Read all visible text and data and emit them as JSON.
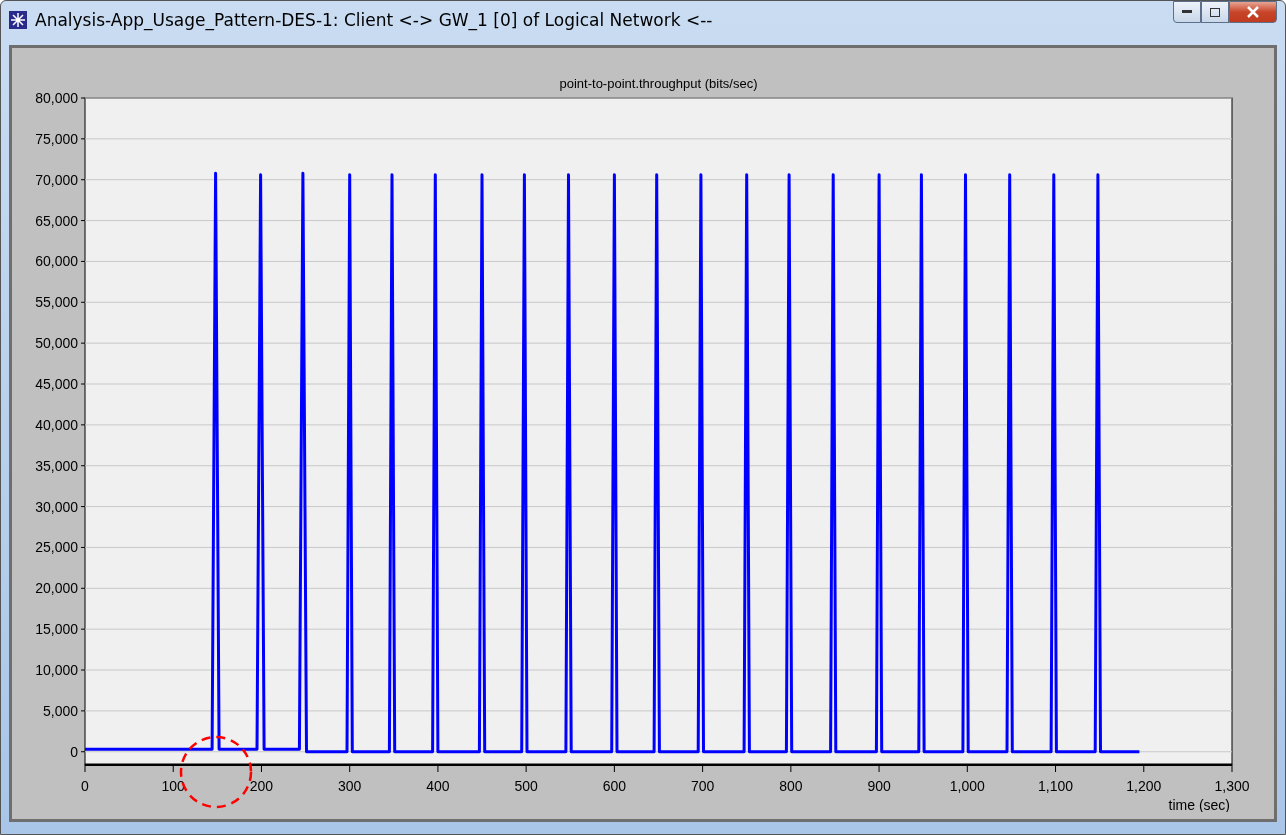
{
  "window": {
    "title": "Analysis-App_Usage_Pattern-DES-1: Client <-> GW_1 [0] of Logical Network <--"
  },
  "chart": {
    "chart_data": {
      "type": "line",
      "grid": true,
      "title": "point-to-point.throughput (bits/sec)",
      "xlabel": "time (sec)",
      "xlim": [
        0,
        1300
      ],
      "ylim": [
        -1500,
        80000
      ],
      "xticks": [
        0,
        100,
        200,
        300,
        400,
        500,
        600,
        700,
        800,
        900,
        {
          "value": 1000,
          "label": "1,000"
        },
        {
          "value": 1100,
          "label": "1,100"
        },
        {
          "value": 1200,
          "label": "1,200"
        },
        {
          "value": 1300,
          "label": "1,300"
        }
      ],
      "yticks": [
        0,
        {
          "value": 5000,
          "label": "5,000"
        },
        {
          "value": 10000,
          "label": "10,000"
        },
        {
          "value": 15000,
          "label": "15,000"
        },
        {
          "value": 20000,
          "label": "20,000"
        },
        {
          "value": 25000,
          "label": "25,000"
        },
        {
          "value": 30000,
          "label": "30,000"
        },
        {
          "value": 35000,
          "label": "35,000"
        },
        {
          "value": 40000,
          "label": "40,000"
        },
        {
          "value": 45000,
          "label": "45,000"
        },
        {
          "value": 50000,
          "label": "50,000"
        },
        {
          "value": 55000,
          "label": "55,000"
        },
        {
          "value": 60000,
          "label": "60,000"
        },
        {
          "value": 65000,
          "label": "65,000"
        },
        {
          "value": 70000,
          "label": "70,000"
        },
        {
          "value": 75000,
          "label": "75,000"
        },
        {
          "value": 80000,
          "label": "80,000"
        }
      ],
      "x": [
        0,
        144,
        148,
        152,
        195,
        199,
        203,
        243,
        247,
        251,
        297,
        300,
        303,
        345,
        348,
        351,
        394,
        397,
        400,
        447,
        450,
        453,
        495,
        498,
        501,
        545,
        548,
        551,
        597,
        600,
        603,
        645,
        648,
        651,
        695,
        698,
        701,
        747,
        750,
        753,
        795,
        798,
        801,
        845,
        848,
        851,
        897,
        900,
        903,
        945,
        948,
        951,
        995,
        998,
        1001,
        1045,
        1048,
        1051,
        1095,
        1098,
        1101,
        1145,
        1148,
        1151,
        1195
      ],
      "series": [
        {
          "color": "#0000ff",
          "values": [
            300,
            300,
            70800,
            300,
            300,
            70600,
            300,
            300,
            70800,
            0,
            0,
            70600,
            0,
            0,
            70600,
            0,
            0,
            70600,
            0,
            0,
            70600,
            0,
            0,
            70600,
            0,
            0,
            70600,
            0,
            0,
            70600,
            0,
            0,
            70600,
            0,
            0,
            70600,
            0,
            0,
            70600,
            0,
            0,
            70600,
            0,
            0,
            70600,
            0,
            0,
            70600,
            0,
            0,
            70600,
            0,
            0,
            70600,
            0,
            0,
            70600,
            0,
            0,
            70600,
            0,
            0,
            70600,
            0,
            0
          ]
        }
      ]
    }
  }
}
